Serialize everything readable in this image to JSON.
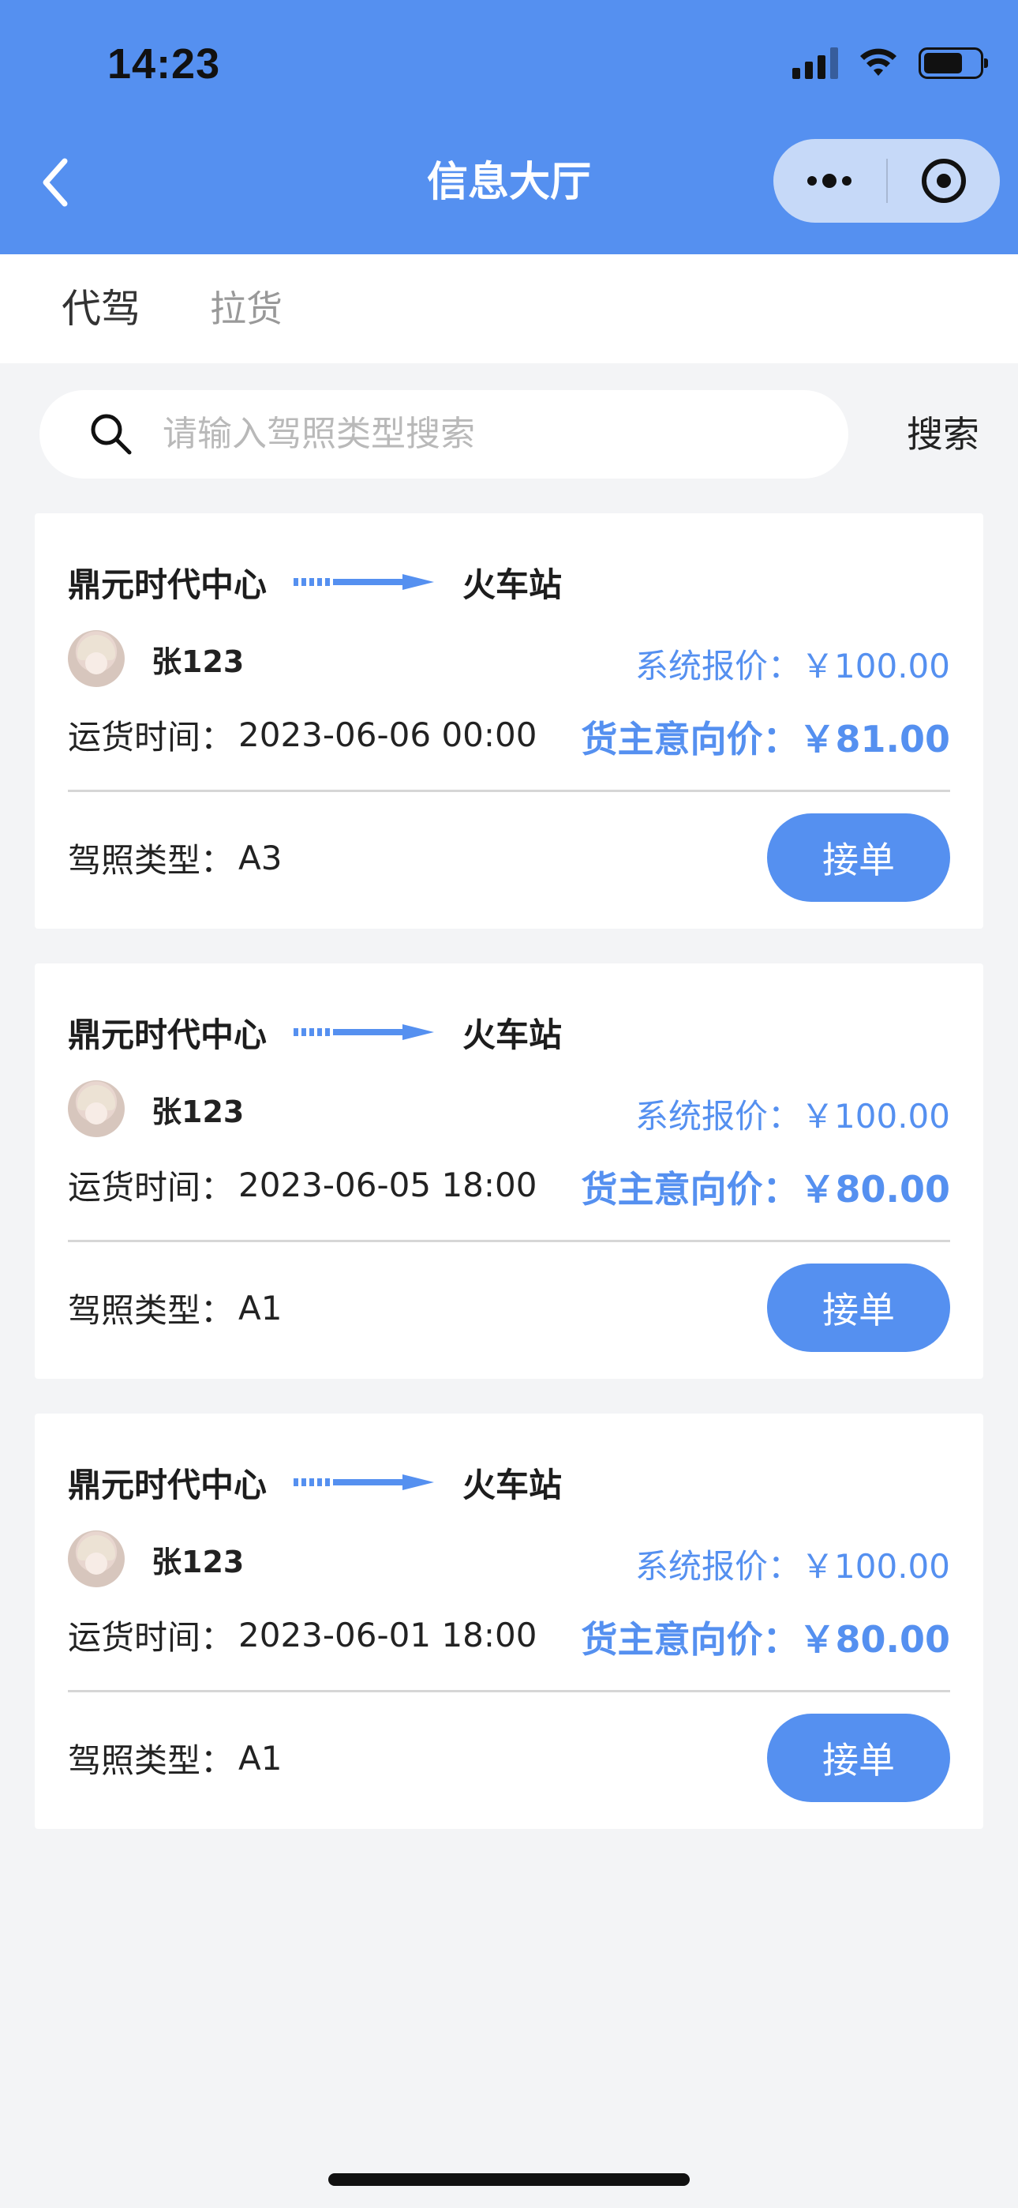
{
  "status_bar": {
    "time": "14:23"
  },
  "nav": {
    "title": "信息大厅"
  },
  "tabs": [
    {
      "label": "代驾",
      "active": true
    },
    {
      "label": "拉货",
      "active": false
    }
  ],
  "search": {
    "placeholder": "请输入驾照类型搜索",
    "button_label": "搜索"
  },
  "orders": [
    {
      "from": "鼎元时代中心",
      "to": "火车站",
      "user": "张123",
      "system_price_label": "系统报价：",
      "system_price": "￥100.00",
      "time_label": "运货时间：",
      "time": "2023-06-06 00:00",
      "owner_price_label": "货主意向价：",
      "owner_price": "￥81.00",
      "license_label": "驾照类型：",
      "license": "A3",
      "accept_label": "接单"
    },
    {
      "from": "鼎元时代中心",
      "to": "火车站",
      "user": "张123",
      "system_price_label": "系统报价：",
      "system_price": "￥100.00",
      "time_label": "运货时间：",
      "time": "2023-06-05 18:00",
      "owner_price_label": "货主意向价：",
      "owner_price": "￥80.00",
      "license_label": "驾照类型：",
      "license": "A1",
      "accept_label": "接单"
    },
    {
      "from": "鼎元时代中心",
      "to": "火车站",
      "user": "张123",
      "system_price_label": "系统报价：",
      "system_price": "￥100.00",
      "time_label": "运货时间：",
      "time": "2023-06-01 18:00",
      "owner_price_label": "货主意向价：",
      "owner_price": "￥80.00",
      "license_label": "驾照类型：",
      "license": "A1",
      "accept_label": "接单"
    }
  ],
  "colors": {
    "primary": "#5590f0",
    "page_bg": "#f3f4f6",
    "capsule_bg": "#c6d9f8"
  }
}
